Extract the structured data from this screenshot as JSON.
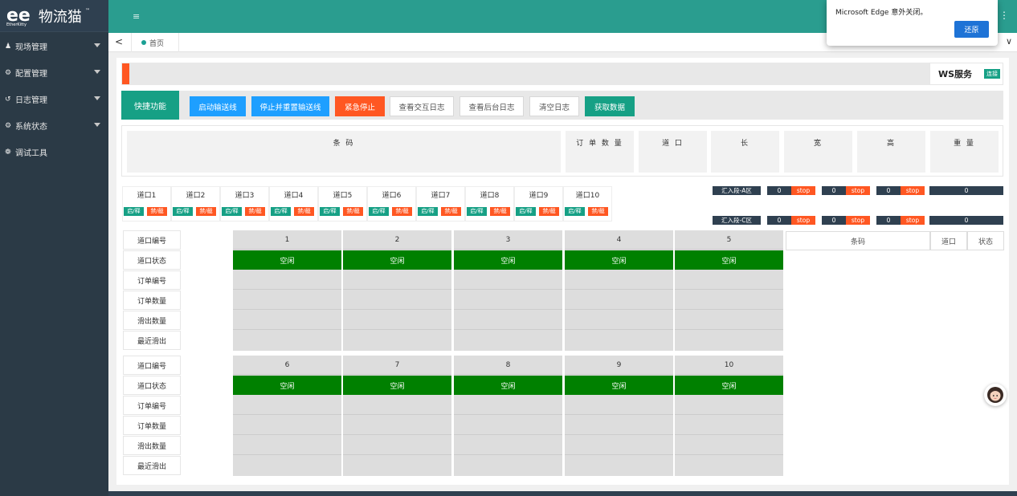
{
  "brand": {
    "logo_mark": "ee",
    "logo_sub": "EtherKitty",
    "name": "物流猫",
    "tm": "™"
  },
  "sidebar": {
    "items": [
      {
        "label": "现场管理",
        "icon": "user-icon",
        "arrow": true
      },
      {
        "label": "配置管理",
        "icon": "gear-icon",
        "arrow": true
      },
      {
        "label": "日志管理",
        "icon": "history-icon",
        "arrow": true
      },
      {
        "label": "系统状态",
        "icon": "gears-icon",
        "arrow": true
      },
      {
        "label": "调试工具",
        "icon": "bug-icon",
        "arrow": false
      }
    ]
  },
  "topbar": {
    "menu_icon": "≡",
    "more_icon": "⋮"
  },
  "tabs": {
    "back": "<",
    "home_label": "首页",
    "expand": "∨"
  },
  "ws": {
    "label": "WS服务",
    "status": "连接"
  },
  "quick": {
    "label": "快捷功能",
    "buttons": [
      "启动输送线",
      "停止并重置输送线",
      "紧急停止",
      "查看交互日志",
      "查看后台日志",
      "清空日志",
      "获取数据"
    ]
  },
  "info_headers": [
    "条 码",
    "订 单 数 量",
    "道 口",
    "长",
    "宽",
    "高",
    "重 量"
  ],
  "doors": {
    "names": [
      "道口1",
      "道口2",
      "道口3",
      "道口4",
      "道口5",
      "道口6",
      "道口7",
      "道口8",
      "道口9",
      "道口10"
    ],
    "enable": "启/释",
    "disable": "禁/截"
  },
  "segments": [
    {
      "name": "汇入段-A区",
      "values": [
        "0",
        "0",
        "0"
      ],
      "stop": "stop",
      "total": "0"
    },
    {
      "name": "汇入段-C区",
      "values": [
        "0",
        "0",
        "0"
      ],
      "stop": "stop",
      "total": "0"
    }
  ],
  "row_labels": [
    "道口编号",
    "道口状态",
    "订单编号",
    "订单数量",
    "滑出数量",
    "最近滑出"
  ],
  "lanes_top": [
    {
      "num": "1",
      "status": "空闲"
    },
    {
      "num": "2",
      "status": "空闲"
    },
    {
      "num": "3",
      "status": "空闲"
    },
    {
      "num": "4",
      "status": "空闲"
    },
    {
      "num": "5",
      "status": "空闲"
    }
  ],
  "lanes_bottom": [
    {
      "num": "6",
      "status": "空闲"
    },
    {
      "num": "7",
      "status": "空闲"
    },
    {
      "num": "8",
      "status": "空闲"
    },
    {
      "num": "9",
      "status": "空闲"
    },
    {
      "num": "10",
      "status": "空闲"
    }
  ],
  "right_table": {
    "headers": [
      "条码",
      "道口",
      "状态"
    ]
  },
  "popup": {
    "message": "Microsoft Edge 意外关闭。",
    "button": "还原"
  },
  "colors": {
    "teal": "#16a085",
    "orange": "#ff5722",
    "blue": "#1e9fff",
    "green": "#008000",
    "sidebar": "#2b3a46"
  }
}
